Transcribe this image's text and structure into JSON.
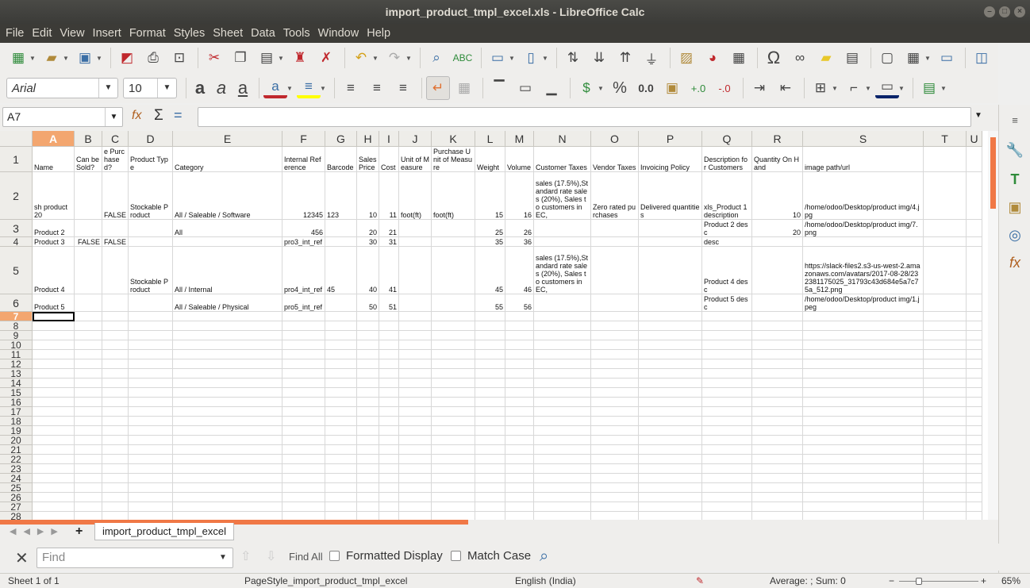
{
  "window": {
    "title": "import_product_tmpl_excel.xls - LibreOffice Calc"
  },
  "menu": [
    "File",
    "Edit",
    "View",
    "Insert",
    "Format",
    "Styles",
    "Sheet",
    "Data",
    "Tools",
    "Window",
    "Help"
  ],
  "format_bar": {
    "font_name": "Arial",
    "font_size": "10"
  },
  "formula_bar": {
    "cell_ref": "A7",
    "content": ""
  },
  "columns": [
    "A",
    "B",
    "C",
    "D",
    "E",
    "F",
    "G",
    "H",
    "I",
    "J",
    "K",
    "L",
    "M",
    "N",
    "O",
    "P",
    "Q",
    "R",
    "S",
    "T",
    "U"
  ],
  "row_numbers": [
    "1",
    "2",
    "3",
    "4",
    "5",
    "6",
    "7",
    "8",
    "9",
    "10",
    "11",
    "12",
    "13",
    "14",
    "15",
    "16",
    "17",
    "18",
    "19",
    "20",
    "21",
    "22",
    "23",
    "24",
    "25",
    "26",
    "27",
    "28"
  ],
  "headers": [
    "Name",
    "Can be Sold?",
    "Can be Purchased?",
    "Product Type",
    "Category",
    "Internal Reference",
    "Barcode",
    "Sales Price",
    "Cost",
    "Unit of Measure",
    "Purchase Unit of Measure",
    "Weight",
    "Volume",
    "Customer Taxes",
    "Vendor Taxes",
    "Invoicing Policy",
    "Description for Customers",
    "Quantity On Hand",
    "image path/url"
  ],
  "rows": [
    [
      "sh product 20",
      "",
      "FALSE",
      "Stockable Product",
      "All / Saleable / Software",
      "12345",
      "123",
      "10",
      "11",
      "foot(ft)",
      "foot(ft)",
      "15",
      "16",
      "sales (17.5%),Standard rate sales (20%), Sales to customers in EC,",
      "Zero rated purchases",
      "Delivered quantities",
      "xls_Product 1 description",
      "10",
      "/home/odoo/Desktop/product img/4.jpg"
    ],
    [
      "Product 2",
      "",
      "",
      "",
      "All",
      "456",
      "",
      "20",
      "21",
      "",
      "",
      "25",
      "26",
      "",
      "",
      "",
      "Product 2 desc",
      "20",
      "/home/odoo/Desktop/product img/7.png"
    ],
    [
      "Product 3",
      "FALSE",
      "FALSE",
      "",
      "",
      "pro3_int_ref",
      "",
      "30",
      "31",
      "",
      "",
      "35",
      "36",
      "",
      "",
      "",
      "desc",
      "",
      ""
    ],
    [
      "Product 4",
      "",
      "",
      "Stockable Product",
      "All / Internal",
      "pro4_int_ref",
      "45",
      "40",
      "41",
      "",
      "",
      "45",
      "46",
      "sales (17.5%),Standard rate sales (20%), Sales to customers in EC,",
      "",
      "",
      "Product 4 desc",
      "",
      "https://slack-files2.s3-us-west-2.amazonaws.com/avatars/2017-08-28/232381175025_31793c43d684e5a7c75a_512.png"
    ],
    [
      "Product 5",
      "",
      "",
      "",
      "All / Saleable / Physical",
      "pro5_int_ref",
      "",
      "50",
      "51",
      "",
      "",
      "55",
      "56",
      "",
      "",
      "",
      "Product 5 desc",
      "",
      "/home/odoo/Desktop/product img/1.jpeg"
    ]
  ],
  "sheet_tab": "import_product_tmpl_excel",
  "find": {
    "placeholder": "Find",
    "find_all": "Find All",
    "formatted_display": "Formatted Display",
    "match_case": "Match Case"
  },
  "status": {
    "sheet": "Sheet 1 of 1",
    "page_style": "PageStyle_import_product_tmpl_excel",
    "language": "English (India)",
    "sum": "Average: ; Sum: 0",
    "zoom": "65%"
  },
  "colors": {
    "accent": "#f07846",
    "titlebar": "#3c3b37"
  }
}
